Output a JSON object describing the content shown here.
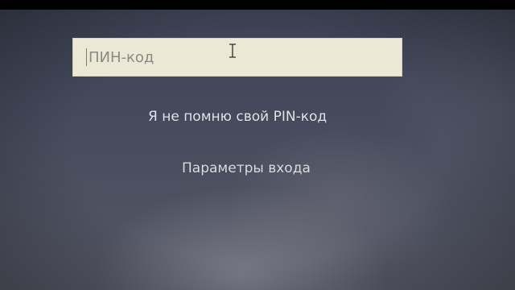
{
  "pin": {
    "placeholder": "ПИН-код",
    "value": ""
  },
  "links": {
    "forgot_pin": "Я не помню свой PIN-код",
    "signin_options": "Параметры входа"
  },
  "icons": {
    "mouse_cursor": "text-ibeam-cursor"
  },
  "colors": {
    "background": "#444a5c",
    "pin_field_background": "#ece8d6",
    "link_text": "#e3e3e6"
  }
}
